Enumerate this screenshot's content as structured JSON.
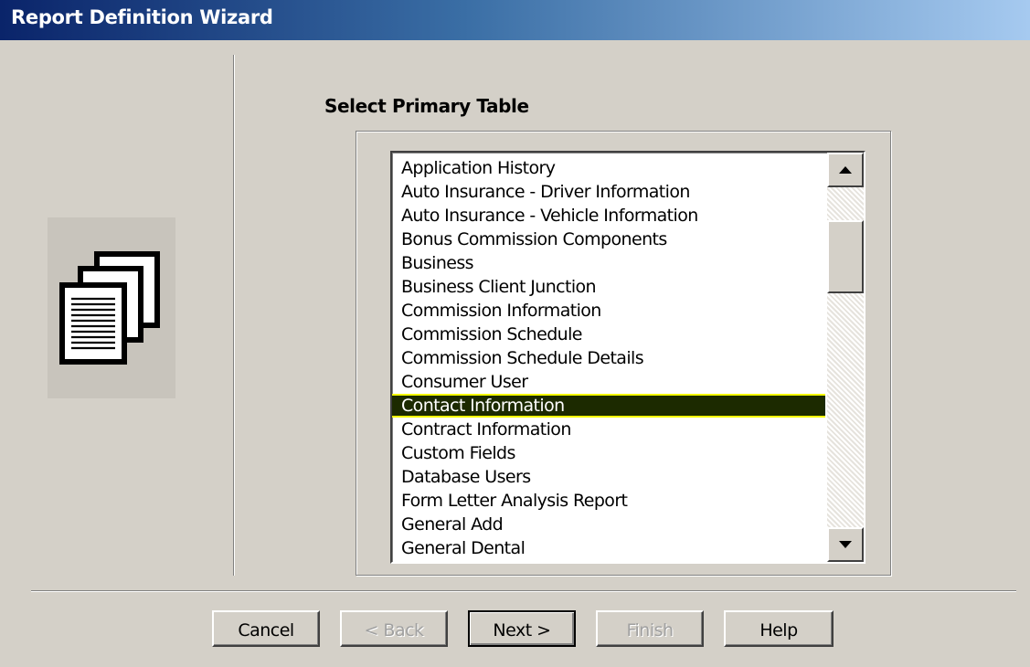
{
  "window": {
    "title": "Report Definition Wizard"
  },
  "page": {
    "heading": "Select Primary Table"
  },
  "list": {
    "items": [
      "Application History",
      "Auto Insurance - Driver Information",
      "Auto Insurance - Vehicle Information",
      "Bonus Commission Components",
      "Business",
      "Business Client Junction",
      "Commission Information",
      "Commission Schedule",
      "Commission Schedule Details",
      "Consumer User",
      "Contact Information",
      "Contract Information",
      "Custom Fields",
      "Database Users",
      "Form Letter Analysis Report",
      "General Add",
      "General Dental"
    ],
    "selected_index": 10
  },
  "buttons": {
    "cancel": "Cancel",
    "back": "< Back",
    "next": "Next >",
    "finish": "Finish",
    "help": "Help"
  },
  "icons": {
    "wizard_icon": "documents-stack-icon",
    "scroll_up": "scroll-up-arrow-icon",
    "scroll_down": "scroll-down-arrow-icon"
  },
  "colors": {
    "title_bar_start": "#0a246a",
    "title_bar_end": "#a6caf0",
    "selection_background": "#1c2a00",
    "selection_border": "#f4ff00"
  }
}
